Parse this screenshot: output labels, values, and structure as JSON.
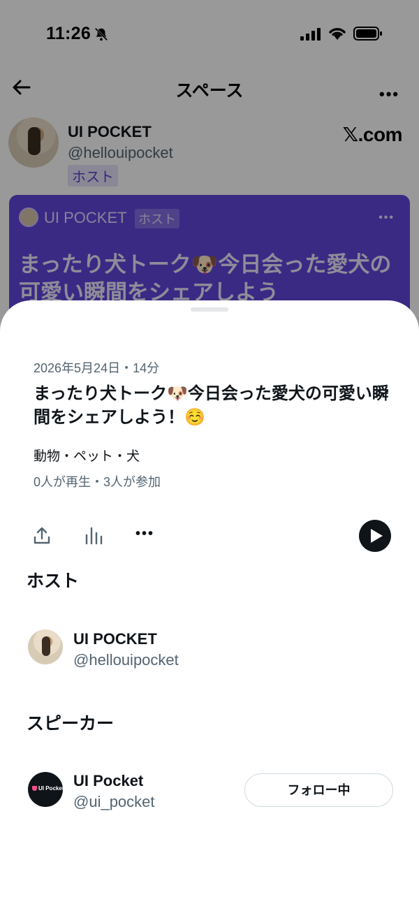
{
  "status_bar": {
    "time": "11:26"
  },
  "nav": {
    "title": "スペース"
  },
  "background": {
    "host_name": "UI POCKET",
    "host_handle": "@hellouipocket",
    "host_badge": "ホスト",
    "brand": "𝕏.com",
    "card": {
      "name": "UI POCKET",
      "badge": "ホスト",
      "title": "まったり犬トーク🐶今日会った愛犬の可愛い瞬間をシェアしよう",
      "color": "#6247dd"
    }
  },
  "sheet": {
    "date_line": "2026年5月24日・14分",
    "title": "まったり犬トーク🐶今日会った愛犬の可愛い瞬間をシェアしよう！☺️",
    "topics": "動物・ペット・犬",
    "stats": "0人が再生・3人が参加",
    "actions": [
      "share-icon",
      "stats-icon",
      "more-icon",
      "play-icon"
    ],
    "host_section": {
      "title": "ホスト",
      "name": "UI POCKET",
      "handle": "@hellouipocket"
    },
    "speaker_section": {
      "title": "スピーカー",
      "name": "UI Pocket",
      "handle": "@ui_pocket",
      "avatar_text": "UI Pocket",
      "follow_label": "フォロー中"
    }
  }
}
